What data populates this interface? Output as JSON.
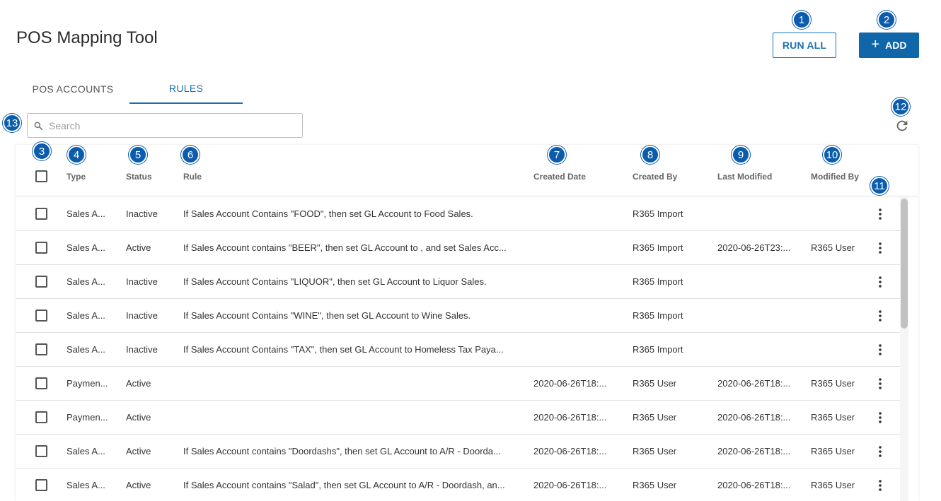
{
  "header": {
    "title": "POS Mapping Tool",
    "run_all_label": "RUN ALL",
    "add_label": "ADD"
  },
  "tabs": [
    {
      "label": "POS ACCOUNTS",
      "active": false
    },
    {
      "label": "RULES",
      "active": true
    }
  ],
  "search": {
    "placeholder": "Search",
    "value": ""
  },
  "icons": {
    "search": "search-icon",
    "refresh": "refresh-icon",
    "plus": "plus-icon",
    "kebab": "more-vert-icon"
  },
  "colors": {
    "primary": "#0f66a8",
    "badge": "#0b5cad",
    "tab_active": "#1a6fae"
  },
  "callouts": [
    "1",
    "2",
    "3",
    "4",
    "5",
    "6",
    "7",
    "8",
    "9",
    "10",
    "11",
    "12",
    "13"
  ],
  "table": {
    "columns": [
      "Type",
      "Status",
      "Rule",
      "Created Date",
      "Created By",
      "Last Modified",
      "Modified By"
    ],
    "rows": [
      {
        "type": "Sales A...",
        "status": "Inactive",
        "rule": "If Sales Account Contains \"FOOD\", then set GL Account to Food Sales.",
        "created_date": "",
        "created_by": "R365 Import",
        "last_modified": "",
        "modified_by": ""
      },
      {
        "type": "Sales A...",
        "status": "Active",
        "rule": "If Sales Account contains \"BEER\", then set GL Account to , and set Sales Acc...",
        "created_date": "",
        "created_by": "R365 Import",
        "last_modified": "2020-06-26T23:...",
        "modified_by": "R365 User"
      },
      {
        "type": "Sales A...",
        "status": "Inactive",
        "rule": "If Sales Account Contains \"LIQUOR\", then set GL Account to Liquor Sales.",
        "created_date": "",
        "created_by": "R365 Import",
        "last_modified": "",
        "modified_by": ""
      },
      {
        "type": "Sales A...",
        "status": "Inactive",
        "rule": "If Sales Account Contains \"WINE\", then set GL Account to Wine Sales.",
        "created_date": "",
        "created_by": "R365 Import",
        "last_modified": "",
        "modified_by": ""
      },
      {
        "type": "Sales A...",
        "status": "Inactive",
        "rule": "If Sales Account Contains \"TAX\", then set GL Account to Homeless Tax Paya...",
        "created_date": "",
        "created_by": "R365 Import",
        "last_modified": "",
        "modified_by": ""
      },
      {
        "type": "Paymen...",
        "status": "Active",
        "rule": "",
        "created_date": "2020-06-26T18:...",
        "created_by": "R365 User",
        "last_modified": "2020-06-26T18:...",
        "modified_by": "R365 User"
      },
      {
        "type": "Paymen...",
        "status": "Active",
        "rule": "",
        "created_date": "2020-06-26T18:...",
        "created_by": "R365 User",
        "last_modified": "2020-06-26T18:...",
        "modified_by": "R365 User"
      },
      {
        "type": "Sales A...",
        "status": "Active",
        "rule": "If Sales Account contains \"Doordashs\", then set GL Account to A/R - Doorda...",
        "created_date": "2020-06-26T18:...",
        "created_by": "R365 User",
        "last_modified": "2020-06-26T18:...",
        "modified_by": "R365 User"
      },
      {
        "type": "Sales A...",
        "status": "Active",
        "rule": "If Sales Account contains \"Salad\", then set GL Account to A/R - Doordash, an...",
        "created_date": "2020-06-26T18:...",
        "created_by": "R365 User",
        "last_modified": "2020-06-26T18:...",
        "modified_by": "R365 User"
      }
    ]
  }
}
